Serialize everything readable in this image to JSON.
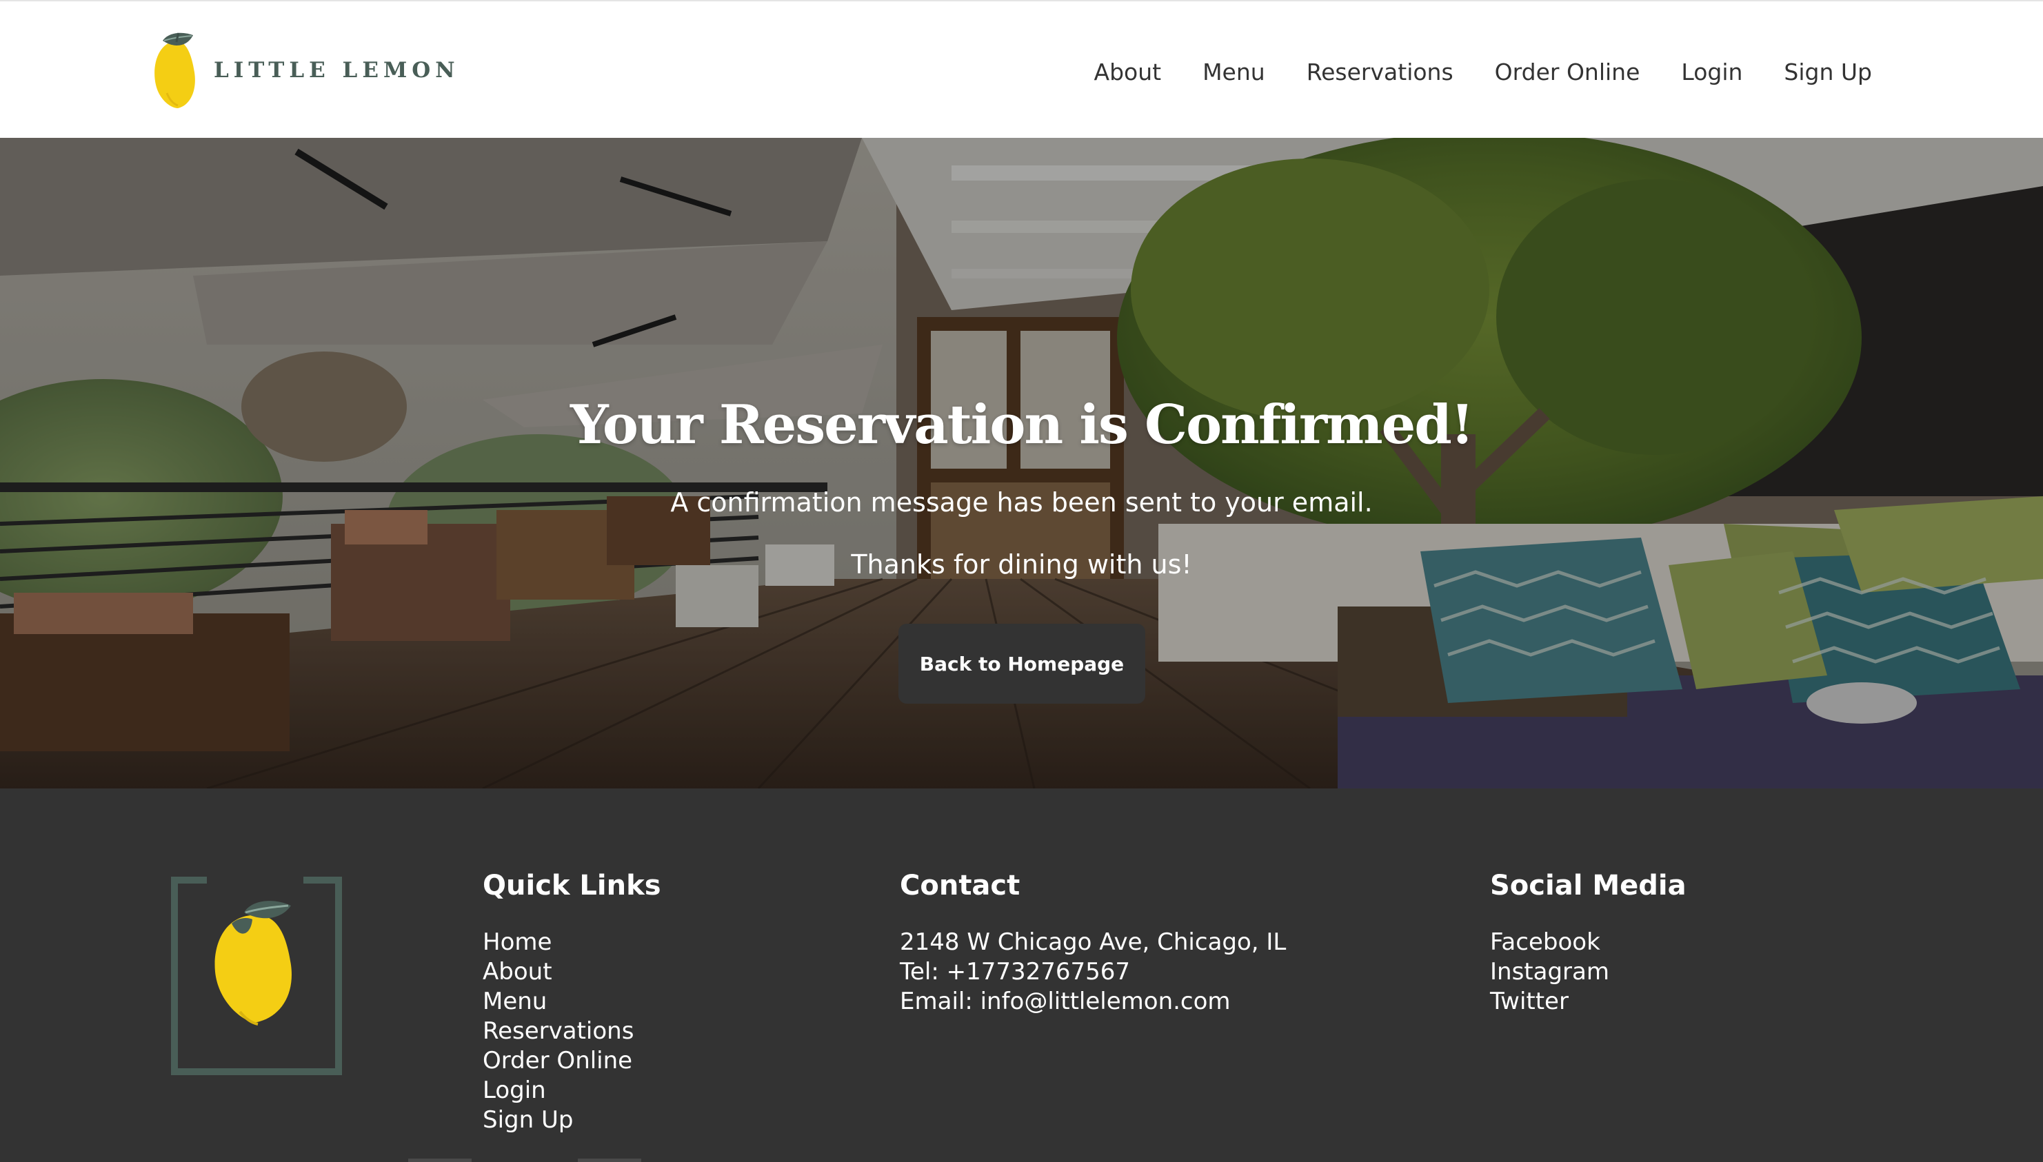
{
  "brand": {
    "name": "LITTLE LEMON"
  },
  "nav": {
    "items": [
      {
        "label": "About"
      },
      {
        "label": "Menu"
      },
      {
        "label": "Reservations"
      },
      {
        "label": "Order Online"
      },
      {
        "label": "Login"
      },
      {
        "label": "Sign Up"
      }
    ]
  },
  "hero": {
    "title": "Your Reservation is Confirmed!",
    "message": "A confirmation message has been sent to your email.",
    "thanks": "Thanks for dining with us!",
    "button_label": "Back to Homepage",
    "background_image": "restaurant-terrace-photo"
  },
  "footer": {
    "quick_links": {
      "heading": "Quick Links",
      "items": [
        "Home",
        "About",
        "Menu",
        "Reservations",
        "Order Online",
        "Login",
        "Sign Up"
      ]
    },
    "contact": {
      "heading": "Contact",
      "address": "2148 W Chicago Ave, Chicago, IL",
      "phone": "Tel: +17732767567",
      "email": "Email: info@littlelemon.com"
    },
    "social": {
      "heading": "Social Media",
      "items": [
        "Facebook",
        "Instagram",
        "Twitter"
      ]
    }
  },
  "colors": {
    "brand_green": "#495e57",
    "brand_yellow": "#f4ce14",
    "dark": "#333333",
    "white": "#ffffff"
  },
  "icons": {
    "header_logo": "lemon-logo-icon",
    "footer_logo": "framed-lemon-logo-icon"
  }
}
